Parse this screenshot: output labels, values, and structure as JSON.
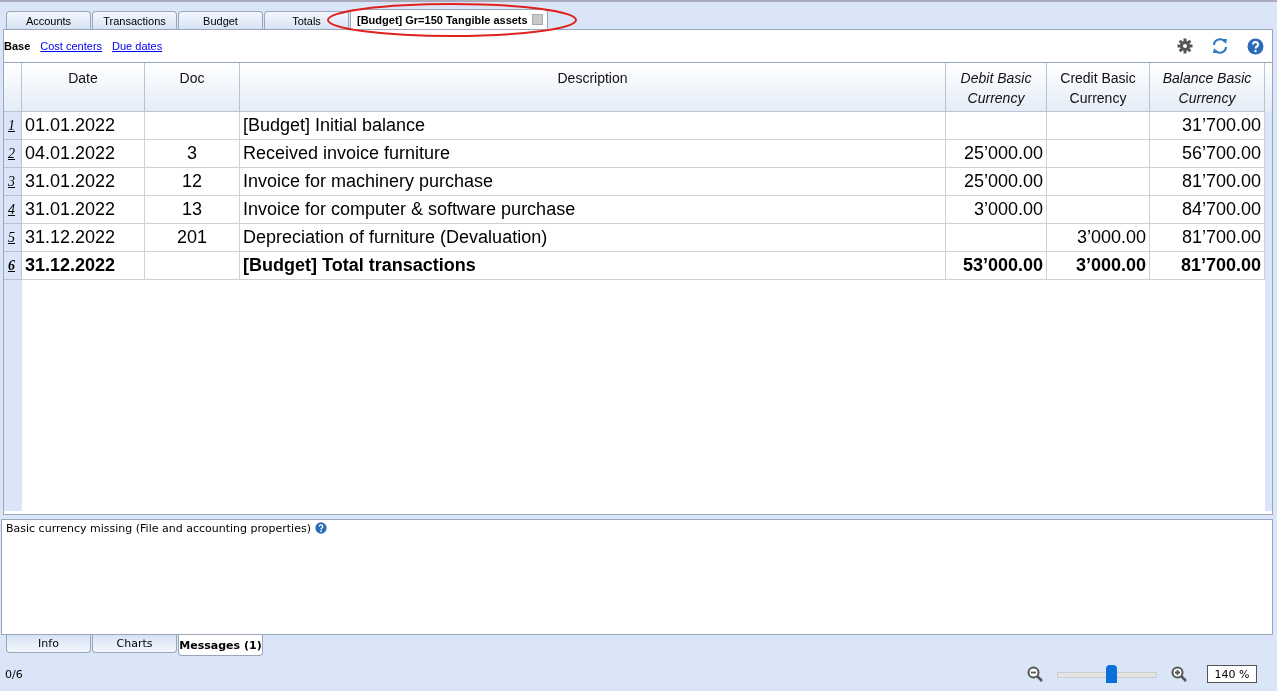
{
  "tabs": [
    {
      "label": "Accounts",
      "selected": false,
      "closable": false
    },
    {
      "label": "Transactions",
      "selected": false,
      "closable": false
    },
    {
      "label": "Budget",
      "selected": false,
      "closable": false
    },
    {
      "label": "Totals",
      "selected": false,
      "closable": false
    },
    {
      "label": "[Budget] Gr=150 Tangible assets",
      "selected": true,
      "closable": true,
      "highlighted": true
    }
  ],
  "views": [
    {
      "label": "Base",
      "selected": true
    },
    {
      "label": "Cost centers",
      "selected": false
    },
    {
      "label": "Due dates",
      "selected": false
    }
  ],
  "table": {
    "columns": [
      {
        "label": "Date",
        "italic": false
      },
      {
        "label": "Doc",
        "italic": false
      },
      {
        "label": "Description",
        "italic": false
      },
      {
        "label": "Debit Basic Currency",
        "italic": true
      },
      {
        "label": "Credit Basic Currency",
        "italic": false
      },
      {
        "label": "Balance Basic Currency",
        "italic": true
      }
    ],
    "rows": [
      {
        "number": "1",
        "kind": "normal",
        "cells": [
          "01.01.2022",
          "",
          "[Budget] Initial balance",
          "",
          "",
          "31’700.00"
        ]
      },
      {
        "number": "2",
        "kind": "normal",
        "cells": [
          "04.01.2022",
          "3",
          "Received invoice furniture",
          "25’000.00",
          "",
          "56’700.00"
        ]
      },
      {
        "number": "3",
        "kind": "normal",
        "cells": [
          "31.01.2022",
          "12",
          "Invoice for machinery purchase",
          "25’000.00",
          "",
          "81’700.00"
        ]
      },
      {
        "number": "4",
        "kind": "normal",
        "cells": [
          "31.01.2022",
          "13",
          "Invoice for computer & software purchase",
          "3’000.00",
          "",
          "84’700.00"
        ]
      },
      {
        "number": "5",
        "kind": "normal",
        "cells": [
          "31.12.2022",
          "201",
          "Depreciation of furniture (Devaluation)",
          "",
          "3’000.00",
          "81’700.00"
        ]
      },
      {
        "number": "6",
        "kind": "total",
        "cells": [
          "31.12.2022",
          "",
          "[Budget] Total transactions",
          "53’000.00",
          "3’000.00",
          "81’700.00"
        ]
      }
    ]
  },
  "message": {
    "text": "Basic currency missing (File and accounting properties)"
  },
  "bottom_tabs": [
    {
      "label": "Info",
      "selected": false
    },
    {
      "label": "Charts",
      "selected": false
    },
    {
      "label": "Messages (1)",
      "selected": true
    }
  ],
  "status_bar": {
    "position": "0/6",
    "zoom": {
      "level": 0.55,
      "value": "140 %"
    }
  }
}
